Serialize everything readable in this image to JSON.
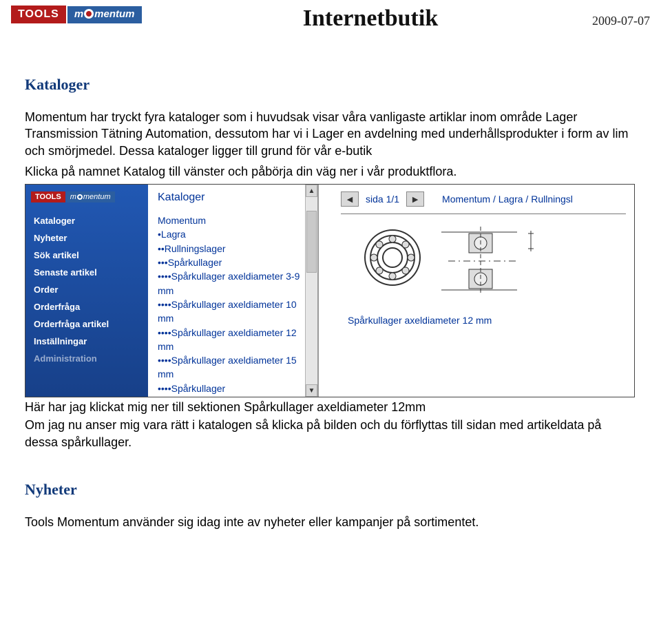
{
  "header": {
    "logo_tools": "TOOLS",
    "logo_brand_prefix": "m",
    "logo_brand_suffix": "mentum",
    "title": "Internetbutik",
    "date": "2009-07-07"
  },
  "section_kataloger": {
    "heading": "Kataloger",
    "p1": "Momentum har tryckt fyra kataloger som i huvudsak visar våra vanligaste artiklar inom område Lager Transmission Tätning Automation, dessutom har vi i Lager en avdelning med underhållsprodukter i form av lim och smörjmedel. Dessa kataloger ligger till grund för vår e-butik",
    "p2": "Klicka på namnet Katalog till vänster och påbörja din väg ner i vår produktflora."
  },
  "screenshot": {
    "sidebar_items": [
      "Kataloger",
      "Nyheter",
      "Sök artikel",
      "Senaste artikel",
      "Order",
      "Orderfråga",
      "Orderfråga artikel",
      "Inställningar",
      "Administration"
    ],
    "tree_title": "Kataloger",
    "tree_items": [
      "Momentum",
      "•Lagra",
      "••Rullningslager",
      "•••Spårkullager",
      "••••Spårkullager axeldiameter 3-9 mm",
      "••••Spårkullager axeldiameter 10 mm",
      "••••Spårkullager axeldiameter 12 mm",
      "••••Spårkullager axeldiameter 15 mm",
      "••••Spårkullager"
    ],
    "pager_text": "sida 1/1",
    "breadcrumb": "Momentum / Lagra / Rullningsl",
    "caption": "Spårkullager axeldiameter 12 mm"
  },
  "after": {
    "p1": "Här har jag klickat mig ner till sektionen Spårkullager axeldiameter 12mm",
    "p2": "Om jag nu anser mig vara rätt i katalogen så klicka på bilden och du förflyttas till sidan med artikeldata på dessa spårkullager."
  },
  "section_nyheter": {
    "heading": "Nyheter",
    "p": "Tools Momentum använder sig idag inte av nyheter eller kampanjer på sortimentet."
  }
}
